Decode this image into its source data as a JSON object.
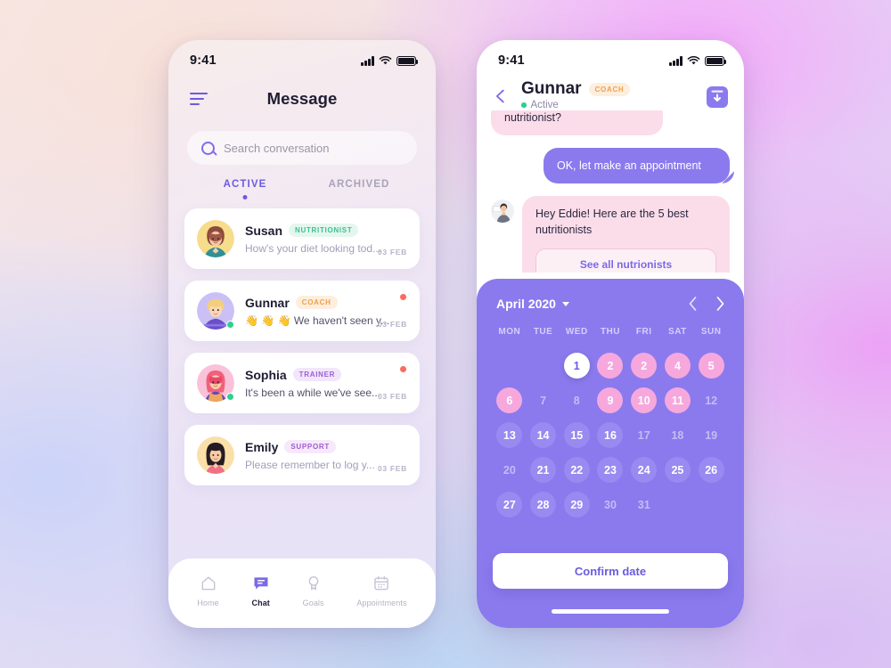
{
  "theme": {
    "accent_purple": "#8a7aee",
    "accent_purple_dark": "#6a5be0",
    "pink_bubble": "#fbdde9",
    "pink_date": "#f6a8dd",
    "online_green": "#2fcf8f",
    "unread_red": "#fb6b5b"
  },
  "left_phone": {
    "status": {
      "time": "9:41"
    },
    "header": {
      "title": "Message",
      "menu_icon": "hamburger-menu-icon"
    },
    "search": {
      "placeholder": "Search conversation",
      "icon": "search-icon"
    },
    "tabs": [
      {
        "label": "ACTIVE",
        "active": true
      },
      {
        "label": "ARCHIVED",
        "active": false
      }
    ],
    "conversations": [
      {
        "name": "Susan",
        "role": "NUTRITIONIST",
        "role_class": "nutritionist",
        "preview": "How's your diet looking tod...",
        "preview_muted": true,
        "date": "03 FEB",
        "online": false,
        "unread": false
      },
      {
        "name": "Gunnar",
        "role": "COACH",
        "role_class": "coach",
        "preview": "👋 👋 👋 We haven't seen y...",
        "preview_muted": false,
        "date": "03 FEB",
        "online": true,
        "unread": true
      },
      {
        "name": "Sophia",
        "role": "TRAINER",
        "role_class": "trainer",
        "preview": "It's been a while we've see...",
        "preview_muted": false,
        "date": "03 FEB",
        "online": true,
        "unread": true
      },
      {
        "name": "Emily",
        "role": "SUPPORT",
        "role_class": "support",
        "preview": "Please remember to log y...",
        "preview_muted": true,
        "date": "03 FEB",
        "online": false,
        "unread": false
      }
    ],
    "tabbar": [
      {
        "label": "Home",
        "icon": "home-icon",
        "active": false
      },
      {
        "label": "Chat",
        "icon": "chat-bubble-icon",
        "active": true
      },
      {
        "label": "Goals",
        "icon": "medal-icon",
        "active": false
      },
      {
        "label": "Appointments",
        "icon": "calendar-icon",
        "active": false
      }
    ]
  },
  "right_phone": {
    "status": {
      "time": "9:41"
    },
    "header": {
      "back_icon": "back-arrow-icon",
      "name": "Gunnar",
      "role": "COACH",
      "presence": "Active",
      "download_icon": "download-icon"
    },
    "messages": [
      {
        "from": "them",
        "text": "nutritionist?",
        "clipped": true
      },
      {
        "from": "me",
        "text": "OK, let make an appointment"
      },
      {
        "from": "them",
        "text": "Hey Eddie! Here are the 5 best nutritionists",
        "avatar": "coach-avatar",
        "action_label": "See all nutrionists"
      }
    ],
    "calendar": {
      "month": "April 2020",
      "prev_icon": "chevron-left-icon",
      "next_icon": "chevron-right-icon",
      "dropdown_icon": "caret-down-icon",
      "weekdays": [
        "MON",
        "TUE",
        "WED",
        "THU",
        "FRI",
        "SAT",
        "SUN"
      ],
      "leading_blanks": 2,
      "days": [
        {
          "n": "1",
          "style": "sel-white"
        },
        {
          "n": "2",
          "style": "pink"
        },
        {
          "n": "2",
          "style": "pink"
        },
        {
          "n": "4",
          "style": "pink"
        },
        {
          "n": "5",
          "style": "pink"
        },
        {
          "n": "6",
          "style": "pink"
        },
        {
          "n": "7",
          "style": "dim"
        },
        {
          "n": "8",
          "style": "dim"
        },
        {
          "n": "9",
          "style": "pink"
        },
        {
          "n": "10",
          "style": "pink"
        },
        {
          "n": "11",
          "style": "pink"
        },
        {
          "n": "12",
          "style": "dim"
        },
        {
          "n": "13",
          "style": "soft"
        },
        {
          "n": "14",
          "style": "soft"
        },
        {
          "n": "15",
          "style": "soft"
        },
        {
          "n": "16",
          "style": "soft"
        },
        {
          "n": "17",
          "style": "dim"
        },
        {
          "n": "18",
          "style": "dim"
        },
        {
          "n": "19",
          "style": "dim"
        },
        {
          "n": "20",
          "style": "dim"
        },
        {
          "n": "21",
          "style": "soft"
        },
        {
          "n": "22",
          "style": "soft"
        },
        {
          "n": "23",
          "style": "soft"
        },
        {
          "n": "24",
          "style": "soft"
        },
        {
          "n": "25",
          "style": "soft"
        },
        {
          "n": "26",
          "style": "soft"
        },
        {
          "n": "27",
          "style": "soft"
        },
        {
          "n": "28",
          "style": "soft"
        },
        {
          "n": "29",
          "style": "soft"
        },
        {
          "n": "30",
          "style": "dim"
        },
        {
          "n": "31",
          "style": "dim"
        }
      ],
      "confirm_label": "Confirm date"
    }
  }
}
